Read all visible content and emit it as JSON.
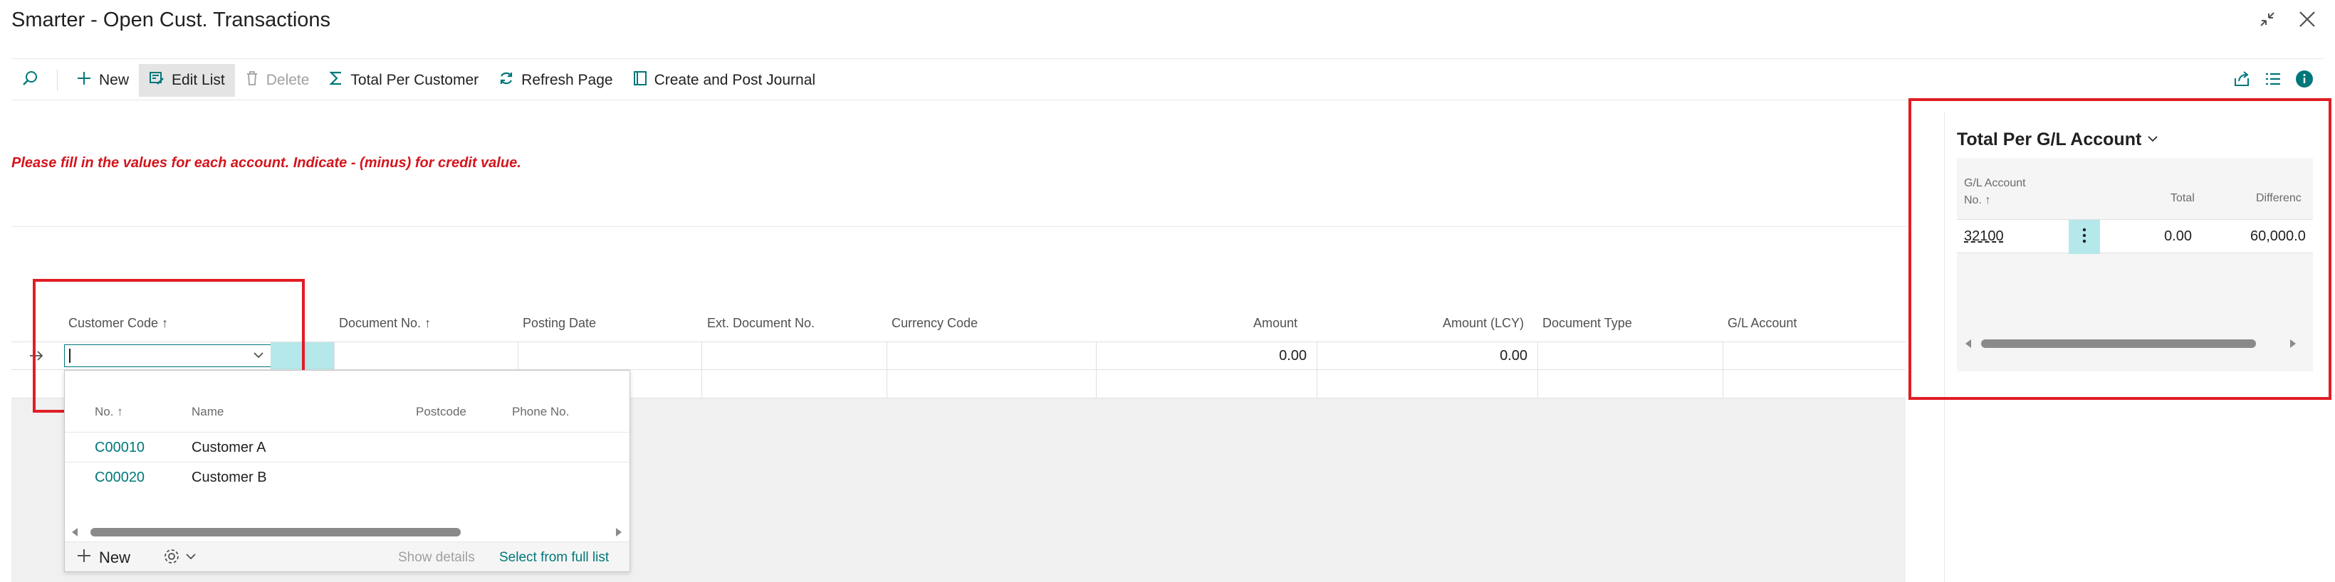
{
  "window": {
    "title": "Smarter - Open Cust. Transactions"
  },
  "toolbar": {
    "new_label": "New",
    "edit_list_label": "Edit List",
    "delete_label": "Delete",
    "total_per_customer_label": "Total Per Customer",
    "refresh_page_label": "Refresh Page",
    "create_post_journal_label": "Create and Post Journal"
  },
  "warning": {
    "text": "Please fill in the values for each account. Indicate - (minus) for credit value."
  },
  "grid": {
    "columns": {
      "customer_code": "Customer Code",
      "document_no": "Document No.",
      "posting_date": "Posting Date",
      "ext_document_no": "Ext. Document No.",
      "currency_code": "Currency Code",
      "amount": "Amount",
      "amount_lcy": "Amount (LCY)",
      "document_type": "Document Type",
      "gl_account": "G/L Account"
    },
    "row": {
      "amount": "0.00",
      "amount_lcy": "0.00"
    }
  },
  "lookup": {
    "columns": {
      "no": "No. ↑",
      "name": "Name",
      "postcode": "Postcode",
      "phone": "Phone No."
    },
    "rows": [
      {
        "no": "C00010",
        "name": "Customer A"
      },
      {
        "no": "C00020",
        "name": "Customer B"
      }
    ],
    "new_label": "New",
    "show_details_label": "Show details",
    "select_full_list_label": "Select from full list"
  },
  "factbox": {
    "title": "Total Per G/L Account",
    "columns": {
      "gl_account_line1": "G/L Account",
      "gl_account_line2": "No. ↑",
      "total": "Total",
      "difference": "Differenc"
    },
    "row": {
      "gl_account": "32100",
      "total": "0.00",
      "difference": "60,000.0"
    }
  },
  "colors": {
    "accent_teal": "#00777a",
    "warning_red": "#d4151c",
    "highlight_red": "#e11d24",
    "selection_cyan": "#b5e8ea"
  }
}
